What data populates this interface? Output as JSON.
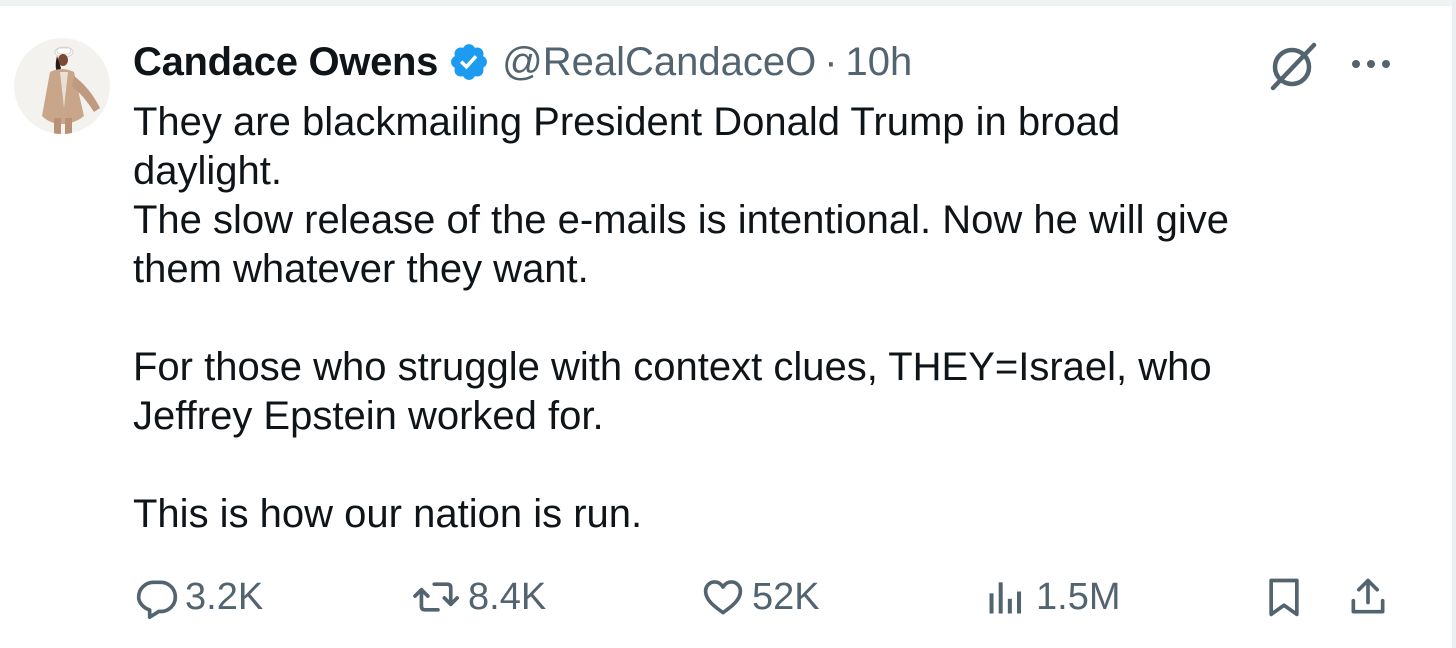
{
  "tweet": {
    "author": {
      "display_name": "Candace Owens",
      "handle": "@RealCandaceO",
      "verified": true,
      "avatar_icon": "user-avatar"
    },
    "separator": "·",
    "timestamp": "10h",
    "body": {
      "lines_p1": [
        "They are blackmailing President Donald Trump in broad",
        "daylight.",
        "The slow release of the e-mails is intentional. Now he will give",
        "them whatever they want."
      ],
      "lines_p2": [
        "For those who struggle with context clues, THEY=Israel, who",
        "Jeffrey Epstein worked for."
      ],
      "lines_p3": [
        "This is how our nation is run."
      ]
    },
    "metrics": {
      "replies": "3.2K",
      "reposts": "8.4K",
      "likes": "52K",
      "views": "1.5M"
    }
  },
  "icons": {
    "verified": "verified-badge-icon",
    "grok": "grok-icon",
    "more": "more-icon",
    "reply": "reply-icon",
    "repost": "repost-icon",
    "like": "heart-icon",
    "views": "views-icon",
    "bookmark": "bookmark-icon",
    "share": "share-icon"
  },
  "colors": {
    "text_primary": "#0f1419",
    "text_secondary": "#536471",
    "verified_blue": "#1d9bf0"
  }
}
